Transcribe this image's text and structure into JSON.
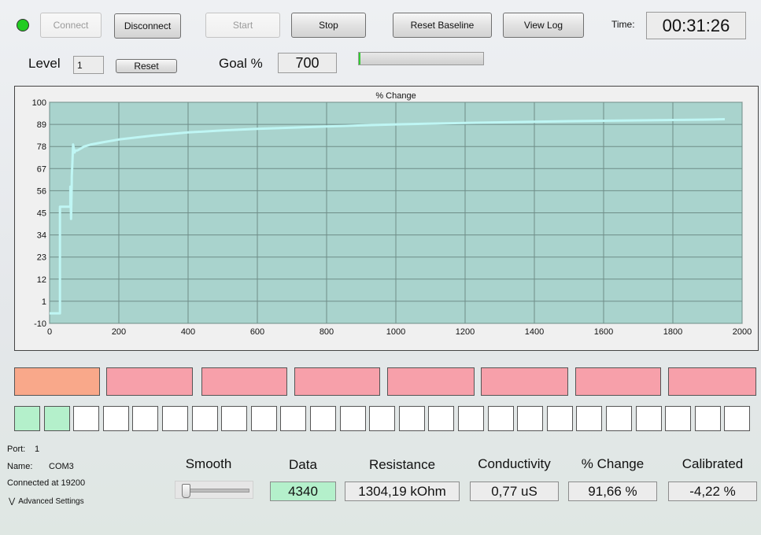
{
  "toolbar": {
    "connect_label": "Connect",
    "disconnect_label": "Disconnect",
    "start_label": "Start",
    "stop_label": "Stop",
    "reset_baseline_label": "Reset Baseline",
    "view_log_label": "View Log",
    "time_label": "Time:",
    "time_value": "00:31:26",
    "status_color": "#22cc22"
  },
  "level": {
    "label": "Level",
    "value": "1",
    "reset_label": "Reset"
  },
  "goal": {
    "label": "Goal %",
    "value": "700",
    "progress": 0.01
  },
  "chart_data": {
    "type": "line",
    "title": "% Change",
    "xlim": [
      0,
      2000
    ],
    "ylim": [
      -10,
      100
    ],
    "x_ticks": [
      0,
      200,
      400,
      600,
      800,
      1000,
      1200,
      1400,
      1600,
      1800,
      2000
    ],
    "y_ticks": [
      -10,
      1,
      12,
      23,
      34,
      45,
      56,
      67,
      78,
      89,
      100
    ],
    "grid": true,
    "background": "#a9d3cd",
    "line_color": "#bff6f4",
    "series": [
      {
        "x": [
          0,
          30,
          30,
          60,
          60,
          62,
          64,
          64,
          66,
          68,
          70,
          72,
          75,
          80,
          90,
          100,
          120,
          150,
          200,
          250,
          300,
          400,
          500,
          600,
          700,
          800,
          900,
          1000,
          1100,
          1200,
          1300,
          1400,
          1500,
          1600,
          1700,
          1800,
          1900,
          1950
        ],
        "y": [
          -5,
          -5,
          48,
          48,
          58,
          42,
          60,
          63,
          70,
          79,
          77,
          75,
          76,
          76,
          77,
          78,
          79,
          80,
          81.5,
          82.5,
          83.5,
          85,
          86,
          86.8,
          87.4,
          88,
          88.5,
          89,
          89.4,
          89.7,
          90,
          90.3,
          90.6,
          90.8,
          91,
          91.2,
          91.4,
          91.6
        ]
      }
    ]
  },
  "channels": {
    "top_colors": [
      "#f9a88a",
      "#f7a0aa",
      "#f7a0aa",
      "#f7a0aa",
      "#f7a0aa",
      "#f7a0aa",
      "#f7a0aa",
      "#f7a0aa"
    ],
    "bottom_active": 2,
    "bottom_active_color": "#b4f0cb",
    "bottom_count": 25
  },
  "info": {
    "port_label": "Port:",
    "port_value": "1",
    "name_label": "Name:",
    "name_value": "COM3",
    "connected_text": "Connected at 19200",
    "advanced_label": "Advanced Settings"
  },
  "readouts": {
    "smooth_label": "Smooth",
    "smooth_level": 0.0,
    "data_label": "Data",
    "data_value": "4340",
    "resistance_label": "Resistance",
    "resistance_value": "1304,19 kOhm",
    "conductivity_label": "Conductivity",
    "conductivity_value": "0,77 uS",
    "change_label": "% Change",
    "change_value": "91,66 %",
    "calibrated_label": "Calibrated",
    "calibrated_value": "-4,22 %"
  }
}
